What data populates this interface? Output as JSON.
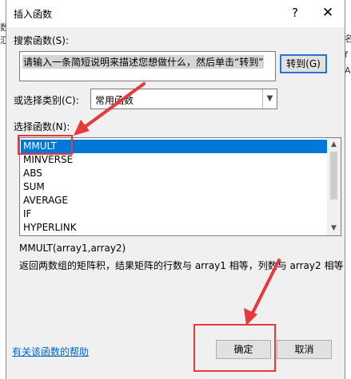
{
  "background": {
    "left_fragments": [
      "数",
      "汇"
    ],
    "right_fragments": [
      "名",
      "f",
      "A"
    ]
  },
  "dialog": {
    "title": "插入函数",
    "help_glyph": "?",
    "close_glyph": "✕",
    "search_label": "搜索函数(S):",
    "search_value": "请输入一条简短说明来描述您想做什么，然后单击“转到”",
    "goto_button": "转到(G)",
    "category_label": "或选择类别(C):",
    "category_value": "常用函数",
    "function_list_label": "选择函数(N):",
    "functions": [
      "MMULT",
      "MINVERSE",
      "ABS",
      "SUM",
      "AVERAGE",
      "IF",
      "HYPERLINK"
    ],
    "selected_function": "MMULT",
    "syntax": "MMULT(array1,array2)",
    "description": "返回两数组的矩阵积，结果矩阵的行数与 array1 相等，列数与 array2 相等",
    "help_link": "有关该函数的帮助",
    "ok_button": "确定",
    "cancel_button": "取消"
  },
  "colors": {
    "annotation_red": "#e5393b",
    "selection_blue": "#0078d7",
    "link_blue": "#0066cc"
  }
}
